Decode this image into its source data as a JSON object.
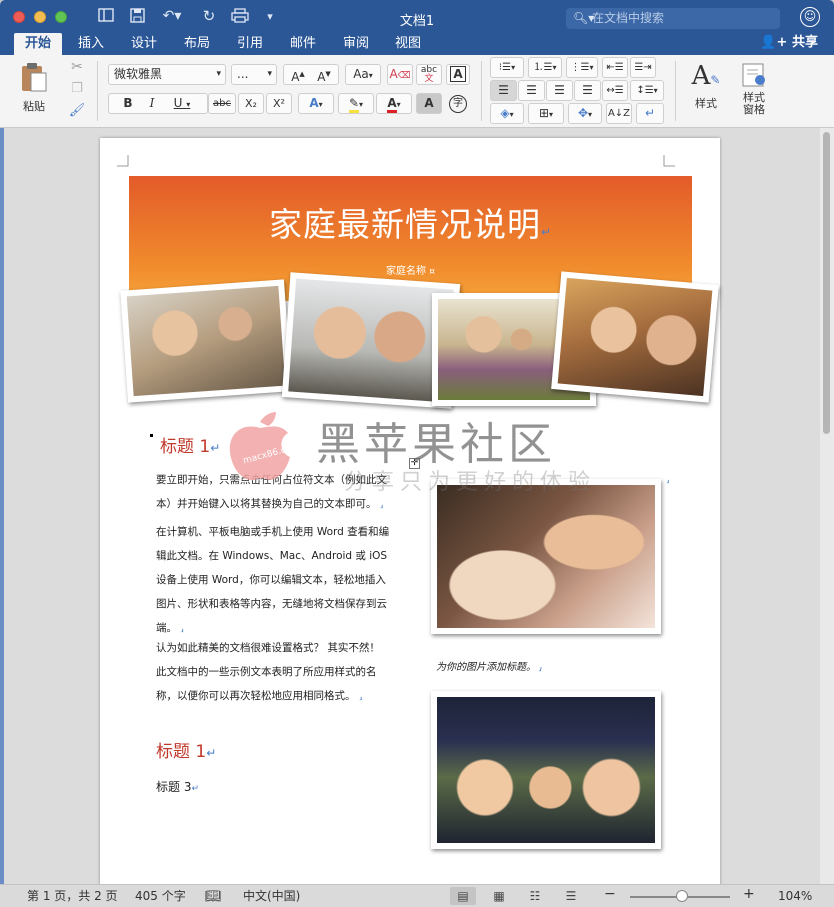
{
  "window": {
    "title": "文档1",
    "search_placeholder": "在文档中搜索",
    "quick_access": [
      "sidebar-icon",
      "save-icon",
      "undo-icon",
      "redo-icon",
      "print-icon",
      "customize-icon"
    ]
  },
  "tabs": [
    {
      "label": "开始",
      "active": true
    },
    {
      "label": "插入"
    },
    {
      "label": "设计"
    },
    {
      "label": "布局"
    },
    {
      "label": "引用"
    },
    {
      "label": "邮件"
    },
    {
      "label": "审阅"
    },
    {
      "label": "视图"
    }
  ],
  "share_label": "共享",
  "ribbon": {
    "paste_label": "粘贴",
    "font_name": "微软雅黑",
    "font_size": "...",
    "bold": "B",
    "italic": "I",
    "underline": "U",
    "strike": "abc",
    "subscript": "X₂",
    "superscript": "X²",
    "grow_font": "A▲",
    "shrink_font": "A▼",
    "change_case": "Aa",
    "phonetic": "abc",
    "styles_label": "样式",
    "styles_pane_label": "样式\n窗格"
  },
  "document": {
    "banner_title": "家庭最新情况说明",
    "banner_subtitle": "家庭名称",
    "heading1a": "标题 1",
    "para1": "要立即开始，只需点击任何占位符文本（例如此文本）并开始键入以将其替换为自己的文本即可。",
    "para2": "在计算机、平板电脑或手机上使用 Word 查看和编辑此文档。在 Windows、Mac、Android 或 iOS 设备上使用 Word，你可以编辑文本，轻松地插入图片、形状和表格等内容，无缝地将文档保存到云端。",
    "para3": "认为如此精美的文档很难设置格式？ 其实不然！ 此文档中的一些示例文本表明了所应用样式的名称，以便你可以再次轻松地应用相同格式。",
    "heading1b": "标题 1",
    "heading3": "标题 3",
    "caption": "为你的图片添加标题。"
  },
  "watermark": {
    "title": "黑苹果社区",
    "subtitle": "分享只为更好的体验",
    "logo_text": "macx86.cn"
  },
  "status": {
    "page": "第 1 页，共 2 页",
    "words": "405 个字",
    "language": "中文(中国)",
    "zoom": "104%"
  },
  "colors": {
    "title_bar": "#2b5797",
    "banner_top": "#e35b2a",
    "banner_bottom": "#f6a23a",
    "heading": "#c0392b"
  }
}
